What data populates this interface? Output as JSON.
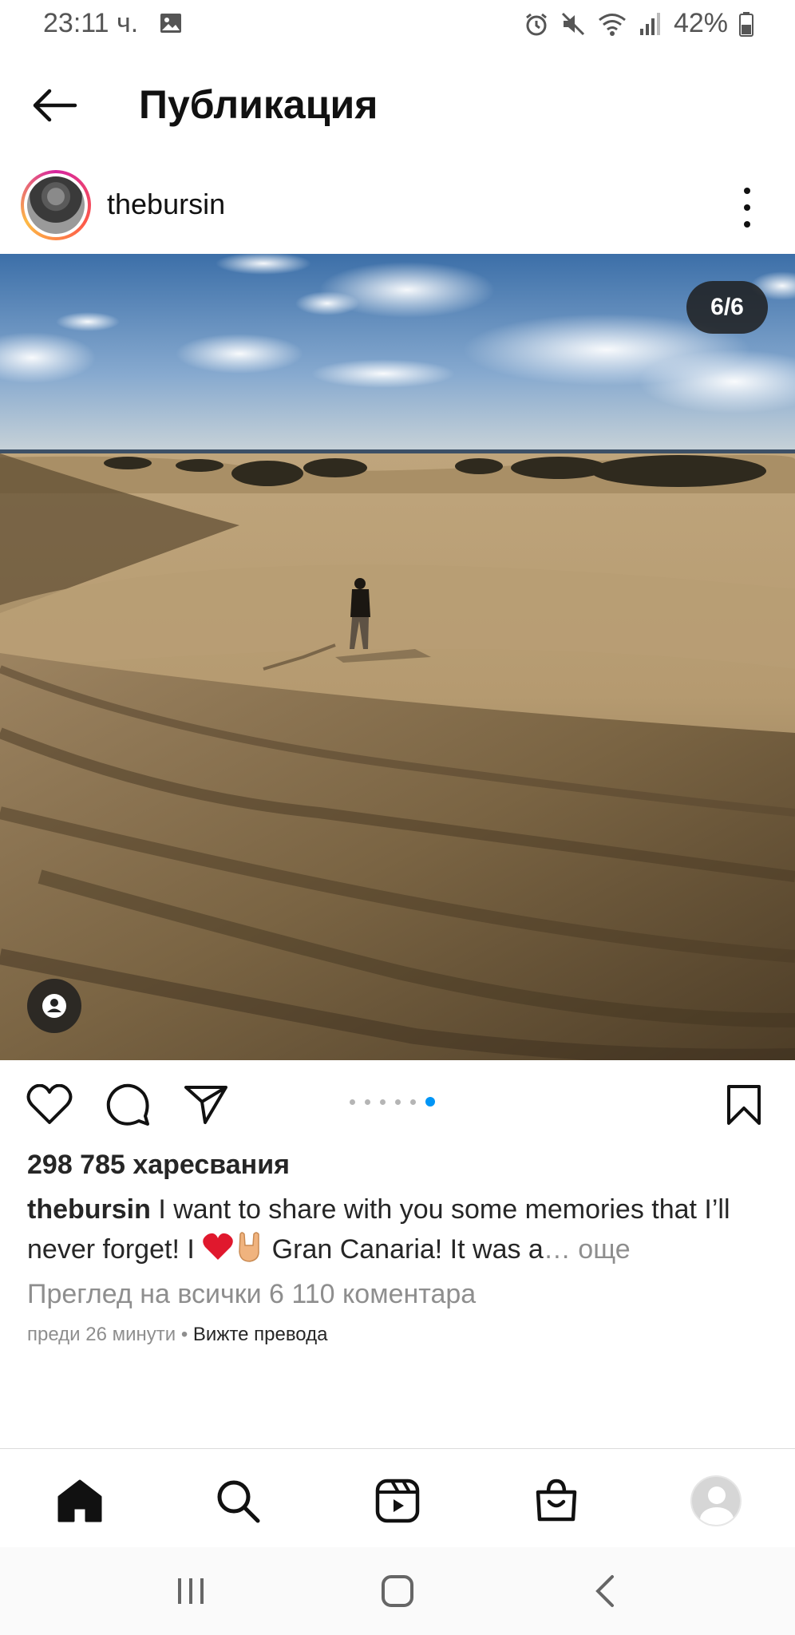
{
  "status_bar": {
    "time": "23:11 ч.",
    "battery": "42%"
  },
  "header": {
    "title": "Публикация"
  },
  "post": {
    "username": "thebursin",
    "counter": "6/6",
    "carousel_active_index": 6,
    "carousel_total": 6,
    "likes": "298 785 харесвания",
    "caption_user": "thebursin",
    "caption_text_1": " I want to share with you some memories that I’ll never forget! I ",
    "caption_text_2": " Gran Canaria! It was a",
    "caption_ellipsis": "… ",
    "caption_more": "още",
    "view_comments": "Преглед на всички 6 110 коментара",
    "time_ago": "преди 26 минути",
    "meta_sep": " • ",
    "see_translation": "Вижте превода"
  },
  "icons": {
    "like": "heart-icon",
    "comment": "comment-icon",
    "share": "send-icon",
    "save": "bookmark-icon"
  },
  "colors": {
    "accent_blue": "#0095f6",
    "muted_text": "#8e8e8e",
    "text": "#262626"
  }
}
